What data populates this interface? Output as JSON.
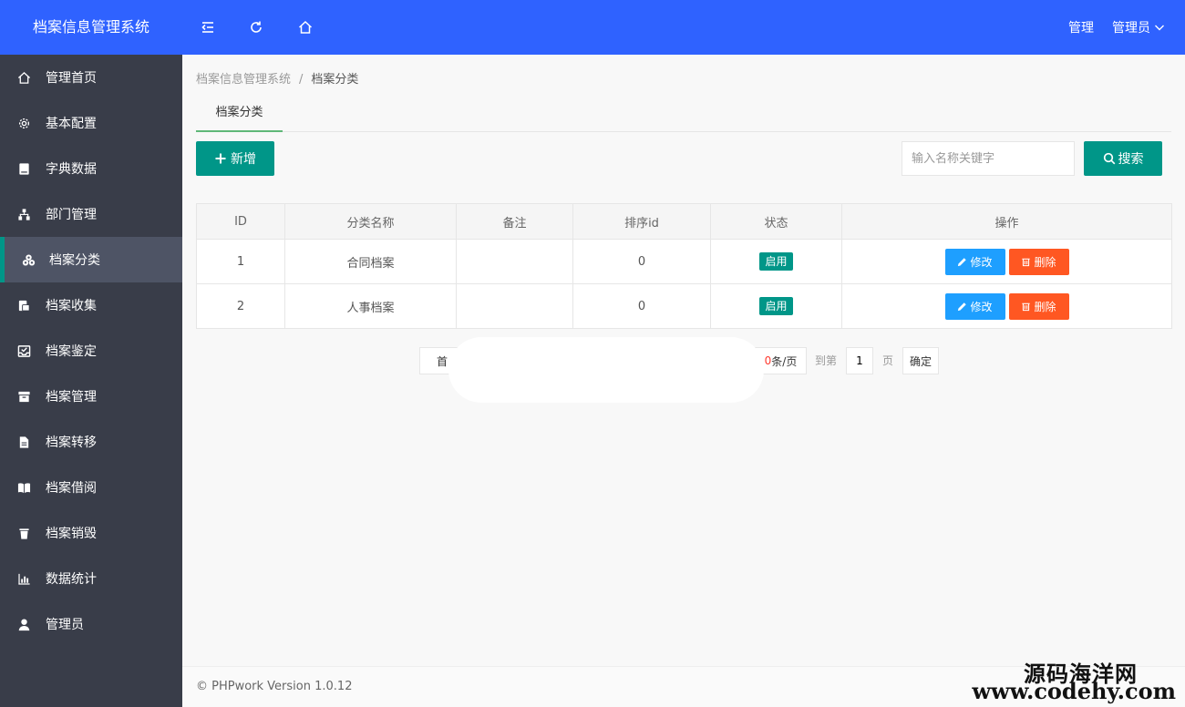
{
  "header": {
    "title": "档案信息管理系统",
    "menu": "管理",
    "user": "管理员"
  },
  "sidebar": {
    "items": [
      {
        "label": "管理首页",
        "icon": "home-icon"
      },
      {
        "label": "基本配置",
        "icon": "gear-icon"
      },
      {
        "label": "字典数据",
        "icon": "book-icon"
      },
      {
        "label": "部门管理",
        "icon": "org-icon"
      },
      {
        "label": "档案分类",
        "icon": "cubes-icon",
        "active": true
      },
      {
        "label": "档案收集",
        "icon": "collect-icon"
      },
      {
        "label": "档案鉴定",
        "icon": "inbox-check-icon"
      },
      {
        "label": "档案管理",
        "icon": "archive-icon"
      },
      {
        "label": "档案转移",
        "icon": "file-icon"
      },
      {
        "label": "档案借阅",
        "icon": "open-book-icon"
      },
      {
        "label": "档案销毁",
        "icon": "trash-icon"
      },
      {
        "label": "数据统计",
        "icon": "bar-chart-icon"
      },
      {
        "label": "管理员",
        "icon": "user-icon"
      }
    ]
  },
  "breadcrumb": {
    "root": "档案信息管理系统",
    "sep": "/",
    "current": "档案分类"
  },
  "tab": {
    "label": "档案分类"
  },
  "toolbar": {
    "add_label": "新增",
    "search_placeholder": "输入名称关键字",
    "search_label": "搜索"
  },
  "table": {
    "headers": [
      "ID",
      "分类名称",
      "备注",
      "排序id",
      "状态",
      "操作"
    ],
    "rows": [
      {
        "id": "1",
        "name": "合同档案",
        "remark": "",
        "sort": "0",
        "status": "启用"
      },
      {
        "id": "2",
        "name": "人事档案",
        "remark": "",
        "sort": "0",
        "status": "启用"
      }
    ],
    "edit_label": "修改",
    "delete_label": "删除"
  },
  "pagination": {
    "first_partial": "首",
    "size_digit": "0",
    "size_suffix": "条/页",
    "goto_label": "到第",
    "page_value": "1",
    "page_suffix": "页",
    "confirm_label": "确定"
  },
  "footer": {
    "text": "© PHPwork Version 1.0.12"
  },
  "watermark": {
    "cn": "源码海洋网",
    "url": "www.codehy.com"
  },
  "colors": {
    "header": "#2f62ff",
    "sidebar": "#393d49",
    "primary": "#009688",
    "edit": "#1e9fff",
    "delete": "#ff5722"
  }
}
